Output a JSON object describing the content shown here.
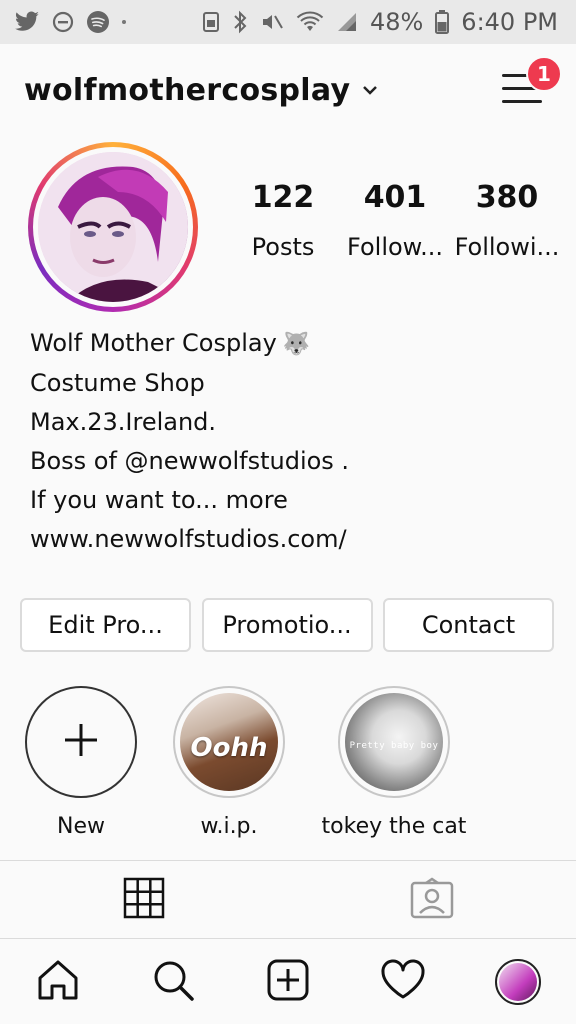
{
  "status_bar": {
    "battery_percent": "48%",
    "time": "6:40 PM"
  },
  "header": {
    "username": "wolfmothercosplay",
    "notification_count": "1"
  },
  "profile": {
    "stats": [
      {
        "value": "122",
        "label": "Posts"
      },
      {
        "value": "401",
        "label": "Follow..."
      },
      {
        "value": "380",
        "label": "Followi..."
      }
    ],
    "bio": {
      "name": "Wolf Mother Cosplay",
      "name_emoji": "🐺",
      "category": "Costume Shop",
      "lines": [
        "Max.23.Ireland.",
        "Boss of @newwolfstudios ."
      ],
      "truncated_line": "If you want to...",
      "more_label": "more",
      "website": "www.newwolfstudios.com/"
    }
  },
  "actions": {
    "edit_profile": "Edit Pro...",
    "promotions": "Promotio...",
    "contact": "Contact"
  },
  "highlights": [
    {
      "label": "New"
    },
    {
      "label": "w.i.p.",
      "caption": "Oohh"
    },
    {
      "label": "tokey the cat",
      "caption": "Pretty baby boy"
    }
  ],
  "icons": {
    "status_left": [
      "twitter-icon",
      "do-not-disturb-icon",
      "spotify-icon"
    ],
    "status_right": [
      "android-icon",
      "bluetooth-icon",
      "mute-icon",
      "wifi-icon",
      "signal-icon",
      "battery-icon"
    ],
    "tabs": [
      "grid-icon",
      "tagged-icon"
    ],
    "nav": [
      "home-icon",
      "search-icon",
      "add-icon",
      "heart-icon",
      "profile-avatar"
    ]
  },
  "colors": {
    "badge": "#ee3a4f",
    "border": "#dbdbdb"
  }
}
